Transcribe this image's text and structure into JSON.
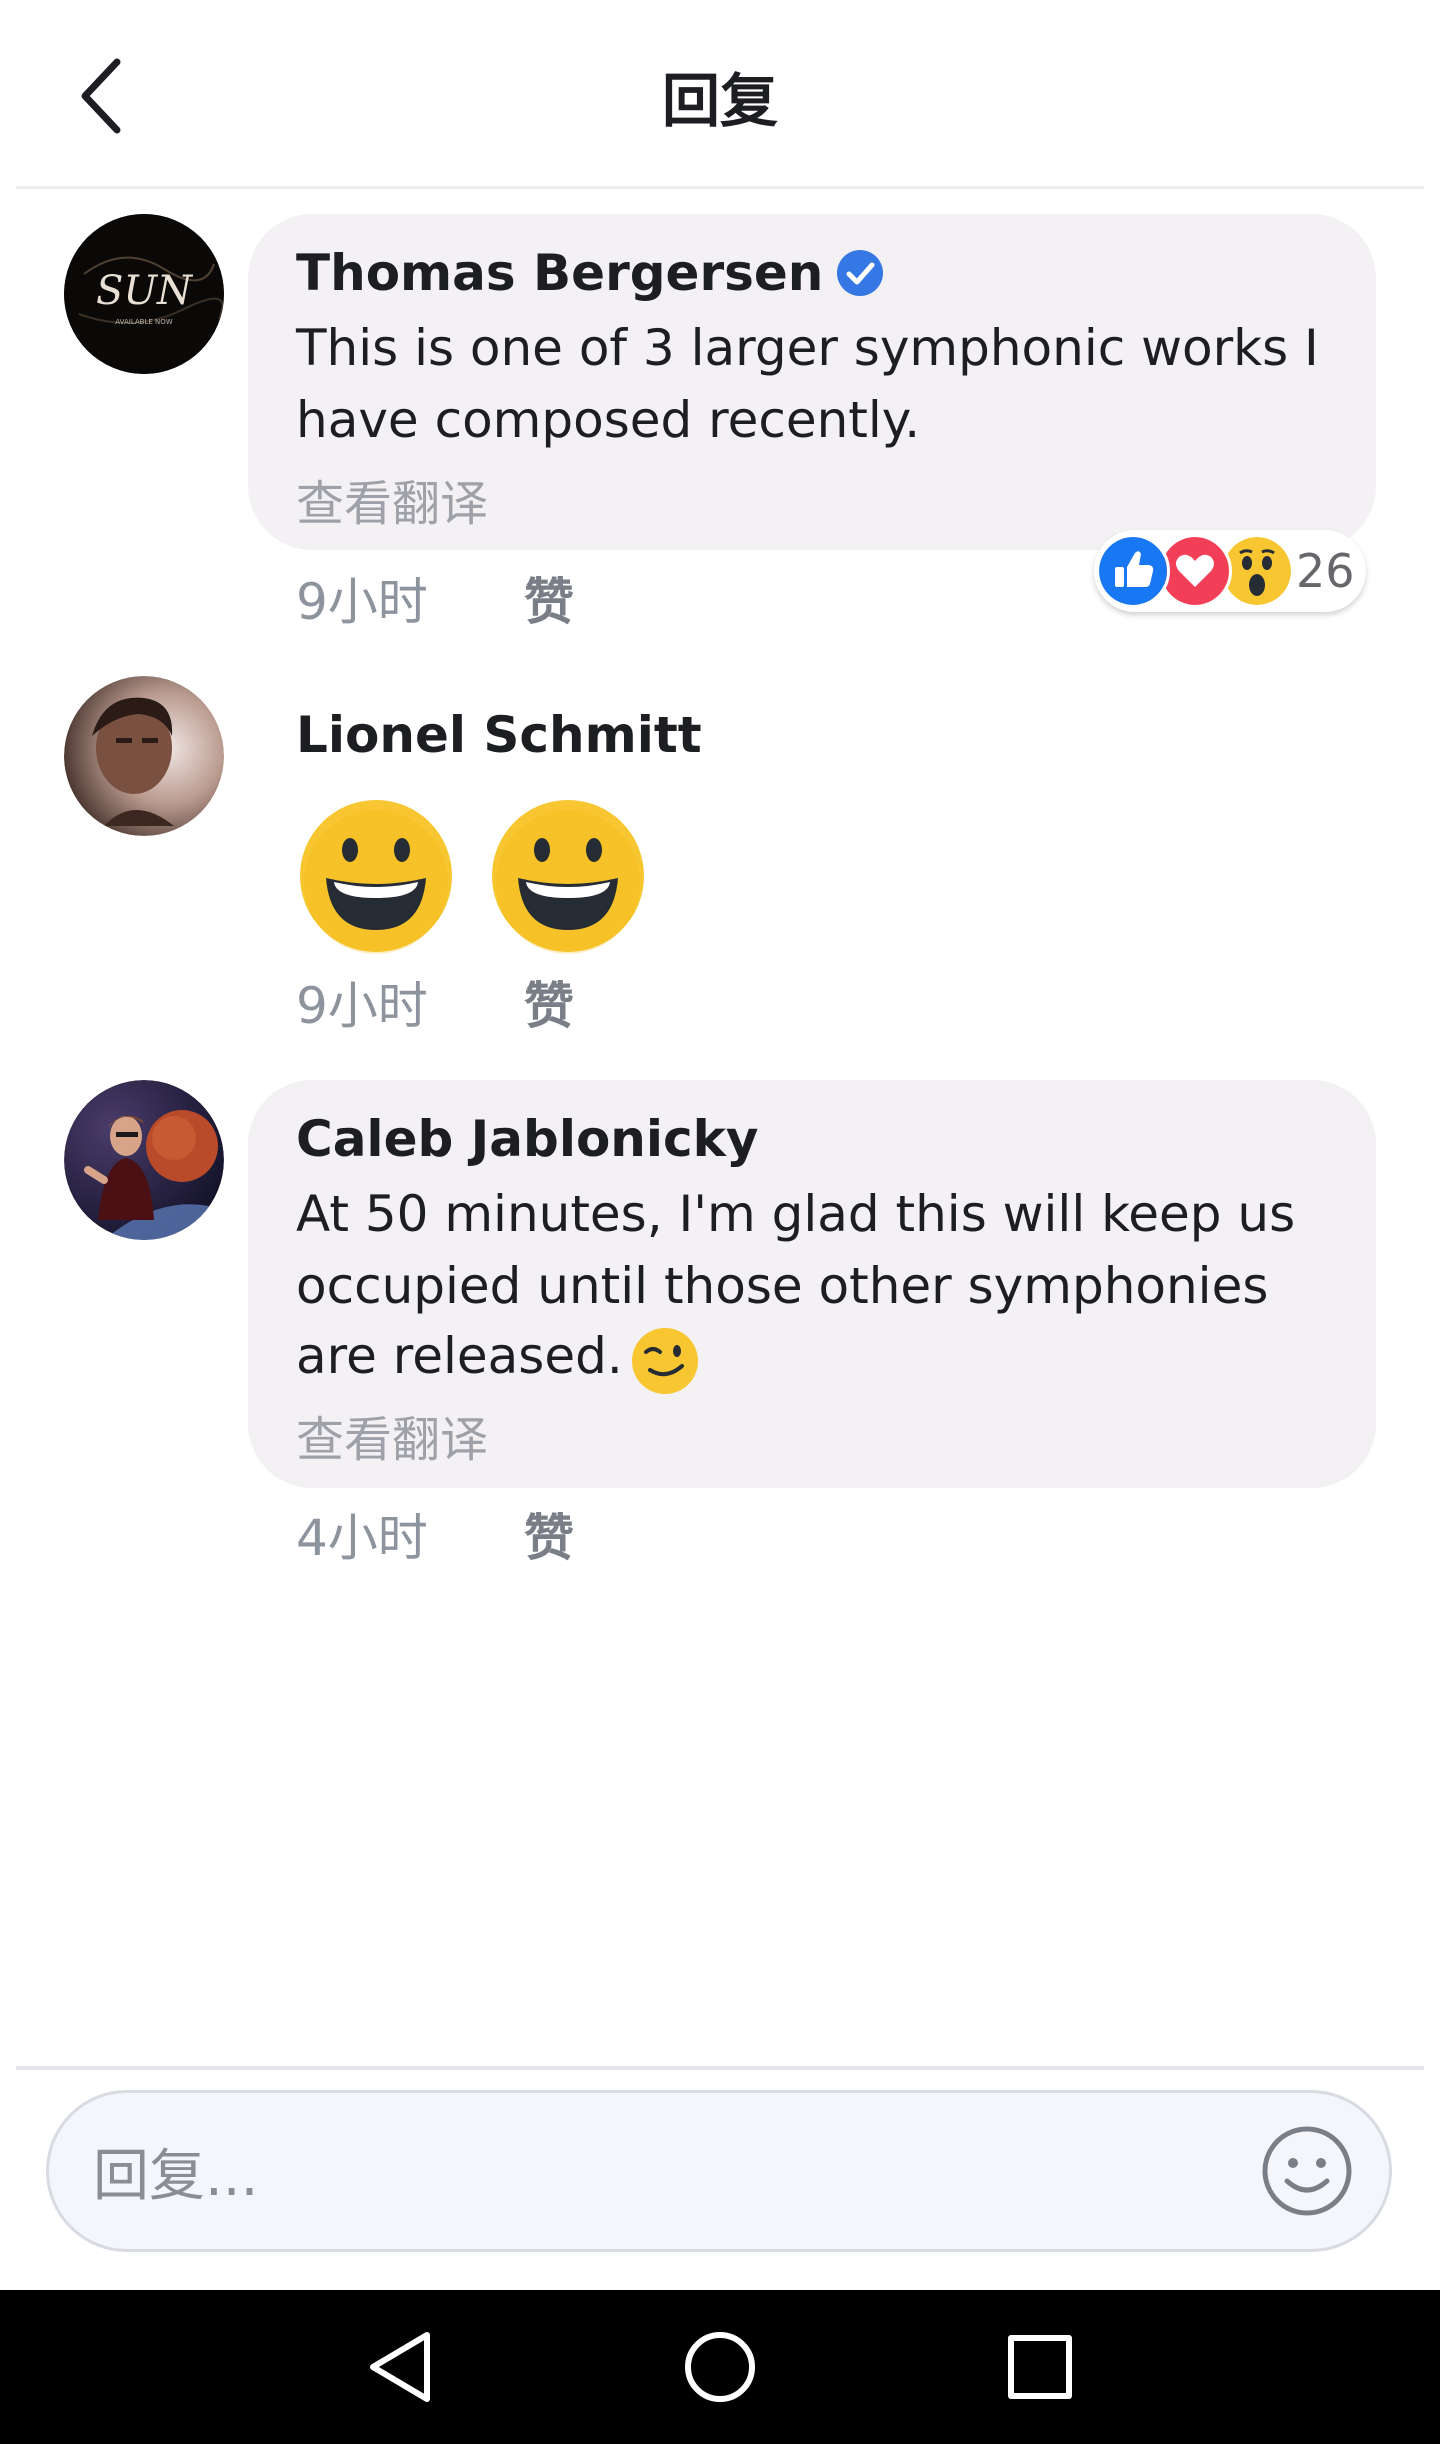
{
  "header": {
    "title": "回复"
  },
  "comments": [
    {
      "author": "Thomas Bergersen",
      "verified": true,
      "text_lines": [
        "This is one of 3 larger symphonic works I",
        "have composed recently."
      ],
      "translate": "查看翻译",
      "time": "9小时",
      "like": "赞",
      "avatar_text": "SUN",
      "avatar_subtext": "AVAILABLE NOW",
      "reactions": {
        "types": [
          "like-icon",
          "love-icon",
          "wow-icon"
        ],
        "count": "26"
      }
    },
    {
      "author": "Lionel Schmitt",
      "emojis": [
        "grinning-face-icon",
        "grinning-face-icon"
      ],
      "time": "9小时",
      "like": "赞"
    },
    {
      "author": "Caleb Jablonicky",
      "text_lines": [
        "At 50 minutes, I'm glad this will keep us",
        "occupied until those other symphonies",
        "are released."
      ],
      "inline_emoji": "winking-face-icon",
      "translate": "查看翻译",
      "time": "4小时",
      "like": "赞"
    }
  ],
  "composer": {
    "placeholder": "回复..."
  },
  "colors": {
    "bubble": "#f4f1f4",
    "verified_blue": "#3578e5",
    "like_blue": "#1877f2",
    "love_red": "#f33e58",
    "emoji_yellow": "#f7c631"
  },
  "navbar": {
    "buttons": [
      "back-triangle-icon",
      "home-circle-icon",
      "recents-square-icon"
    ]
  }
}
